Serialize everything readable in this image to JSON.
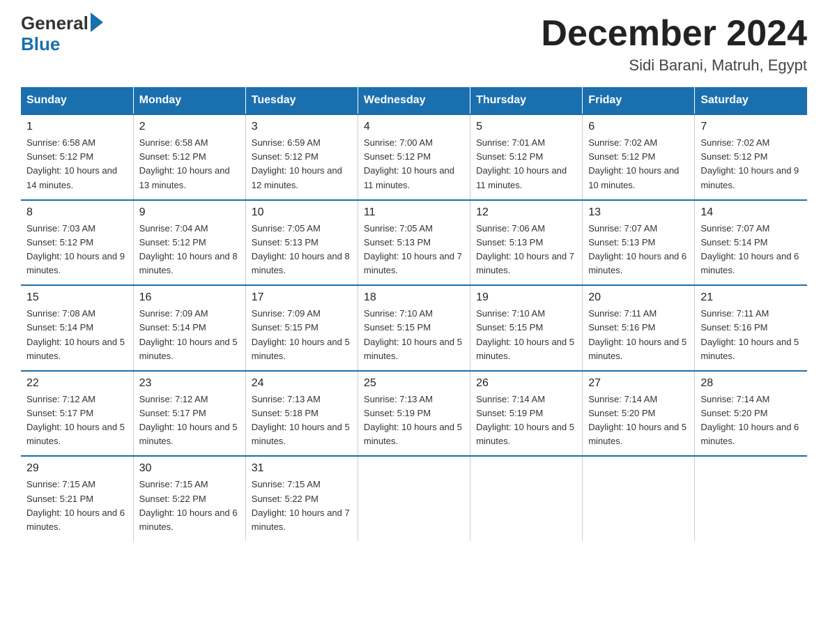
{
  "header": {
    "logo_general": "General",
    "logo_blue": "Blue",
    "title": "December 2024",
    "subtitle": "Sidi Barani, Matruh, Egypt"
  },
  "days_of_week": [
    "Sunday",
    "Monday",
    "Tuesday",
    "Wednesday",
    "Thursday",
    "Friday",
    "Saturday"
  ],
  "weeks": [
    [
      {
        "day": "1",
        "sunrise": "6:58 AM",
        "sunset": "5:12 PM",
        "daylight": "10 hours and 14 minutes."
      },
      {
        "day": "2",
        "sunrise": "6:58 AM",
        "sunset": "5:12 PM",
        "daylight": "10 hours and 13 minutes."
      },
      {
        "day": "3",
        "sunrise": "6:59 AM",
        "sunset": "5:12 PM",
        "daylight": "10 hours and 12 minutes."
      },
      {
        "day": "4",
        "sunrise": "7:00 AM",
        "sunset": "5:12 PM",
        "daylight": "10 hours and 11 minutes."
      },
      {
        "day": "5",
        "sunrise": "7:01 AM",
        "sunset": "5:12 PM",
        "daylight": "10 hours and 11 minutes."
      },
      {
        "day": "6",
        "sunrise": "7:02 AM",
        "sunset": "5:12 PM",
        "daylight": "10 hours and 10 minutes."
      },
      {
        "day": "7",
        "sunrise": "7:02 AM",
        "sunset": "5:12 PM",
        "daylight": "10 hours and 9 minutes."
      }
    ],
    [
      {
        "day": "8",
        "sunrise": "7:03 AM",
        "sunset": "5:12 PM",
        "daylight": "10 hours and 9 minutes."
      },
      {
        "day": "9",
        "sunrise": "7:04 AM",
        "sunset": "5:12 PM",
        "daylight": "10 hours and 8 minutes."
      },
      {
        "day": "10",
        "sunrise": "7:05 AM",
        "sunset": "5:13 PM",
        "daylight": "10 hours and 8 minutes."
      },
      {
        "day": "11",
        "sunrise": "7:05 AM",
        "sunset": "5:13 PM",
        "daylight": "10 hours and 7 minutes."
      },
      {
        "day": "12",
        "sunrise": "7:06 AM",
        "sunset": "5:13 PM",
        "daylight": "10 hours and 7 minutes."
      },
      {
        "day": "13",
        "sunrise": "7:07 AM",
        "sunset": "5:13 PM",
        "daylight": "10 hours and 6 minutes."
      },
      {
        "day": "14",
        "sunrise": "7:07 AM",
        "sunset": "5:14 PM",
        "daylight": "10 hours and 6 minutes."
      }
    ],
    [
      {
        "day": "15",
        "sunrise": "7:08 AM",
        "sunset": "5:14 PM",
        "daylight": "10 hours and 5 minutes."
      },
      {
        "day": "16",
        "sunrise": "7:09 AM",
        "sunset": "5:14 PM",
        "daylight": "10 hours and 5 minutes."
      },
      {
        "day": "17",
        "sunrise": "7:09 AM",
        "sunset": "5:15 PM",
        "daylight": "10 hours and 5 minutes."
      },
      {
        "day": "18",
        "sunrise": "7:10 AM",
        "sunset": "5:15 PM",
        "daylight": "10 hours and 5 minutes."
      },
      {
        "day": "19",
        "sunrise": "7:10 AM",
        "sunset": "5:15 PM",
        "daylight": "10 hours and 5 minutes."
      },
      {
        "day": "20",
        "sunrise": "7:11 AM",
        "sunset": "5:16 PM",
        "daylight": "10 hours and 5 minutes."
      },
      {
        "day": "21",
        "sunrise": "7:11 AM",
        "sunset": "5:16 PM",
        "daylight": "10 hours and 5 minutes."
      }
    ],
    [
      {
        "day": "22",
        "sunrise": "7:12 AM",
        "sunset": "5:17 PM",
        "daylight": "10 hours and 5 minutes."
      },
      {
        "day": "23",
        "sunrise": "7:12 AM",
        "sunset": "5:17 PM",
        "daylight": "10 hours and 5 minutes."
      },
      {
        "day": "24",
        "sunrise": "7:13 AM",
        "sunset": "5:18 PM",
        "daylight": "10 hours and 5 minutes."
      },
      {
        "day": "25",
        "sunrise": "7:13 AM",
        "sunset": "5:19 PM",
        "daylight": "10 hours and 5 minutes."
      },
      {
        "day": "26",
        "sunrise": "7:14 AM",
        "sunset": "5:19 PM",
        "daylight": "10 hours and 5 minutes."
      },
      {
        "day": "27",
        "sunrise": "7:14 AM",
        "sunset": "5:20 PM",
        "daylight": "10 hours and 5 minutes."
      },
      {
        "day": "28",
        "sunrise": "7:14 AM",
        "sunset": "5:20 PM",
        "daylight": "10 hours and 6 minutes."
      }
    ],
    [
      {
        "day": "29",
        "sunrise": "7:15 AM",
        "sunset": "5:21 PM",
        "daylight": "10 hours and 6 minutes."
      },
      {
        "day": "30",
        "sunrise": "7:15 AM",
        "sunset": "5:22 PM",
        "daylight": "10 hours and 6 minutes."
      },
      {
        "day": "31",
        "sunrise": "7:15 AM",
        "sunset": "5:22 PM",
        "daylight": "10 hours and 7 minutes."
      },
      null,
      null,
      null,
      null
    ]
  ]
}
